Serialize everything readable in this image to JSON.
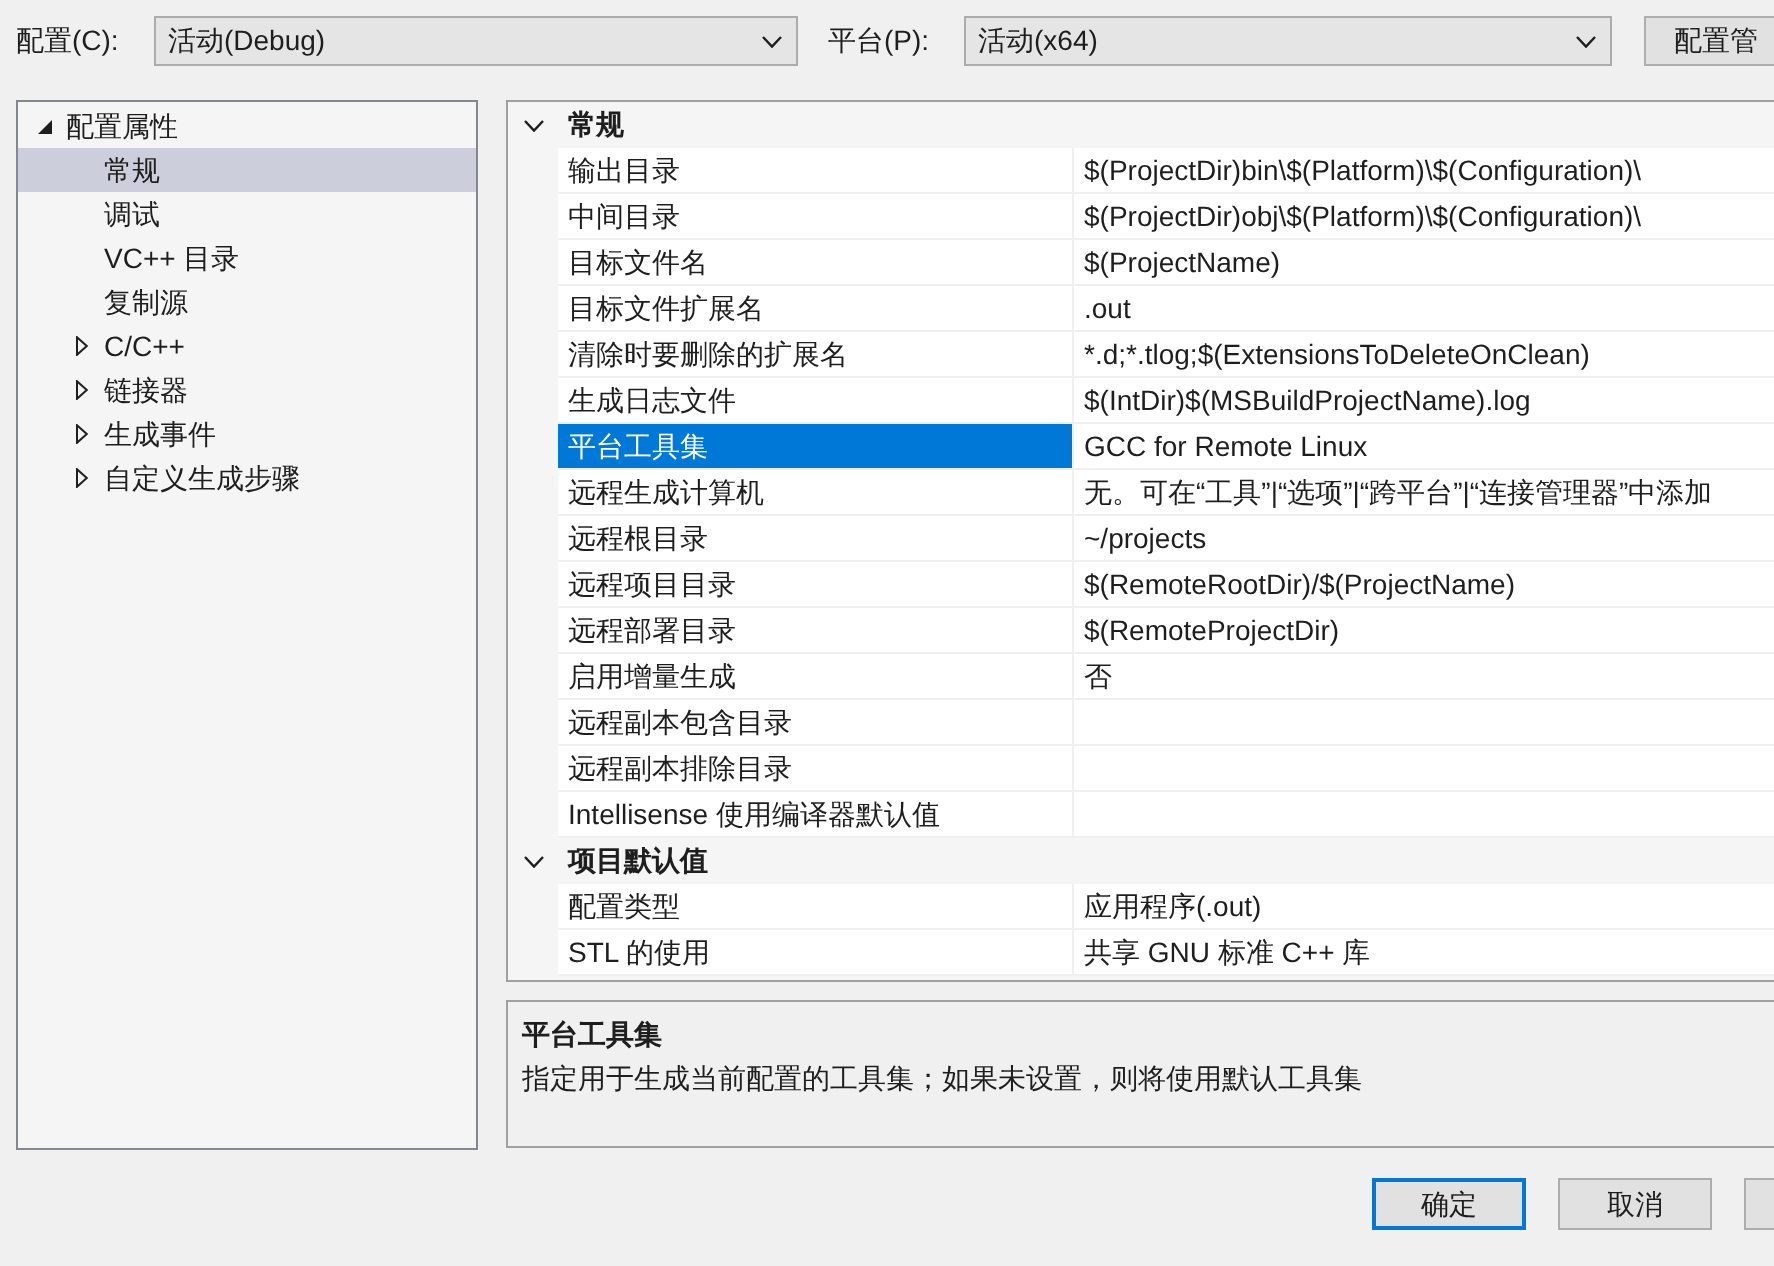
{
  "toolbar": {
    "configuration": {
      "label": "配置(C):",
      "value": "活动(Debug)"
    },
    "platform": {
      "label": "平台(P):",
      "value": "活动(x64)"
    },
    "manager_button": "配置管"
  },
  "tree": [
    {
      "label": "配置属性",
      "kind": "group",
      "expanded": true,
      "selected": false,
      "children": [
        {
          "label": "常规",
          "kind": "page",
          "selected": true
        },
        {
          "label": "调试",
          "kind": "page",
          "selected": false
        },
        {
          "label": "VC++ 目录",
          "kind": "page",
          "selected": false
        },
        {
          "label": "复制源",
          "kind": "page",
          "selected": false
        },
        {
          "label": "C/C++",
          "kind": "group",
          "expanded": false,
          "selected": false
        },
        {
          "label": "链接器",
          "kind": "group",
          "expanded": false,
          "selected": false
        },
        {
          "label": "生成事件",
          "kind": "group",
          "expanded": false,
          "selected": false
        },
        {
          "label": "自定义生成步骤",
          "kind": "group",
          "expanded": false,
          "selected": false
        }
      ]
    }
  ],
  "property_grid": {
    "categories": [
      {
        "label": "常规",
        "expanded": true,
        "properties": [
          {
            "name": "输出目录",
            "value": "$(ProjectDir)bin\\$(Platform)\\$(Configuration)\\",
            "selected": false
          },
          {
            "name": "中间目录",
            "value": "$(ProjectDir)obj\\$(Platform)\\$(Configuration)\\",
            "selected": false
          },
          {
            "name": "目标文件名",
            "value": "$(ProjectName)",
            "selected": false
          },
          {
            "name": "目标文件扩展名",
            "value": ".out",
            "selected": false
          },
          {
            "name": "清除时要删除的扩展名",
            "value": "*.d;*.tlog;$(ExtensionsToDeleteOnClean)",
            "selected": false
          },
          {
            "name": "生成日志文件",
            "value": "$(IntDir)$(MSBuildProjectName).log",
            "selected": false
          },
          {
            "name": "平台工具集",
            "value": "GCC for Remote Linux",
            "selected": true
          },
          {
            "name": "远程生成计算机",
            "value": "无。可在“工具”|“选项”|“跨平台”|“连接管理器”中添加",
            "selected": false
          },
          {
            "name": "远程根目录",
            "value": "~/projects",
            "selected": false
          },
          {
            "name": "远程项目目录",
            "value": "$(RemoteRootDir)/$(ProjectName)",
            "selected": false
          },
          {
            "name": "远程部署目录",
            "value": "$(RemoteProjectDir)",
            "selected": false
          },
          {
            "name": "启用增量生成",
            "value": "否",
            "selected": false
          },
          {
            "name": "远程副本包含目录",
            "selected": false
          },
          {
            "name": "远程副本排除目录",
            "selected": false
          },
          {
            "name": "Intellisense 使用编译器默认值",
            "selected": false
          }
        ]
      },
      {
        "label": "项目默认值",
        "expanded": true,
        "properties": [
          {
            "name": "配置类型",
            "value": "应用程序(.out)",
            "selected": false
          },
          {
            "name": "STL 的使用",
            "value": "共享 GNU 标准 C++ 库",
            "selected": false
          }
        ]
      }
    ]
  },
  "description": {
    "title": "平台工具集",
    "text": "指定用于生成当前配置的工具集；如果未设置，则将使用默认工具集"
  },
  "buttons": [
    {
      "label": "确定",
      "default": true
    },
    {
      "label": "取消",
      "default": false
    }
  ]
}
